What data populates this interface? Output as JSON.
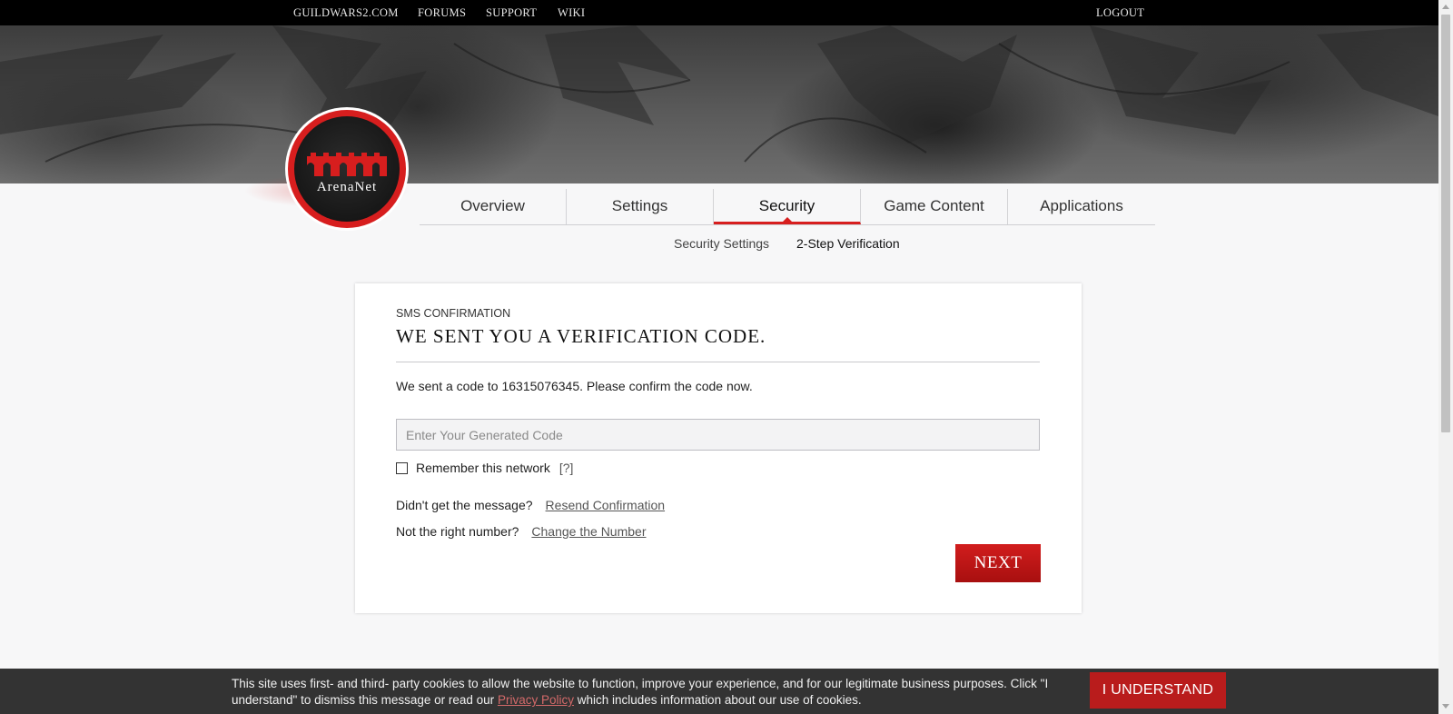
{
  "topbar": {
    "links": [
      "GUILDWARS2.COM",
      "FORUMS",
      "SUPPORT",
      "WIKI"
    ],
    "logout": "LOGOUT"
  },
  "logo": {
    "name": "ArenaNet"
  },
  "nav": {
    "tabs": [
      "Overview",
      "Settings",
      "Security",
      "Game Content",
      "Applications"
    ],
    "active_tab": "Security",
    "subtabs": [
      "Security Settings",
      "2-Step Verification"
    ]
  },
  "card": {
    "eyebrow": "SMS CONFIRMATION",
    "headline": "We sent you a verification code.",
    "message": "We sent a code to 16315076345. Please confirm the code now.",
    "code_input": {
      "placeholder": "Enter Your Generated Code",
      "value": ""
    },
    "remember": {
      "label": "Remember this network",
      "checked": false,
      "help": "[?]"
    },
    "resend": {
      "prompt": "Didn't get the message?",
      "link": "Resend Confirmation"
    },
    "change": {
      "prompt": "Not the right number?",
      "link": "Change the Number"
    },
    "next_label": "NEXT"
  },
  "cookie": {
    "text_before": "This site uses first- and third- party cookies to allow the website to function, improve your experience, and for our legitimate business purposes. Click \"I understand\" to dismiss this message or read our",
    "link": "Privacy Policy",
    "text_after": "which includes information about our use of cookies.",
    "button": "I UNDERSTAND"
  },
  "colors": {
    "accent": "#d71e1e",
    "topbar": "#000000",
    "cookie_bg": "#333333"
  }
}
